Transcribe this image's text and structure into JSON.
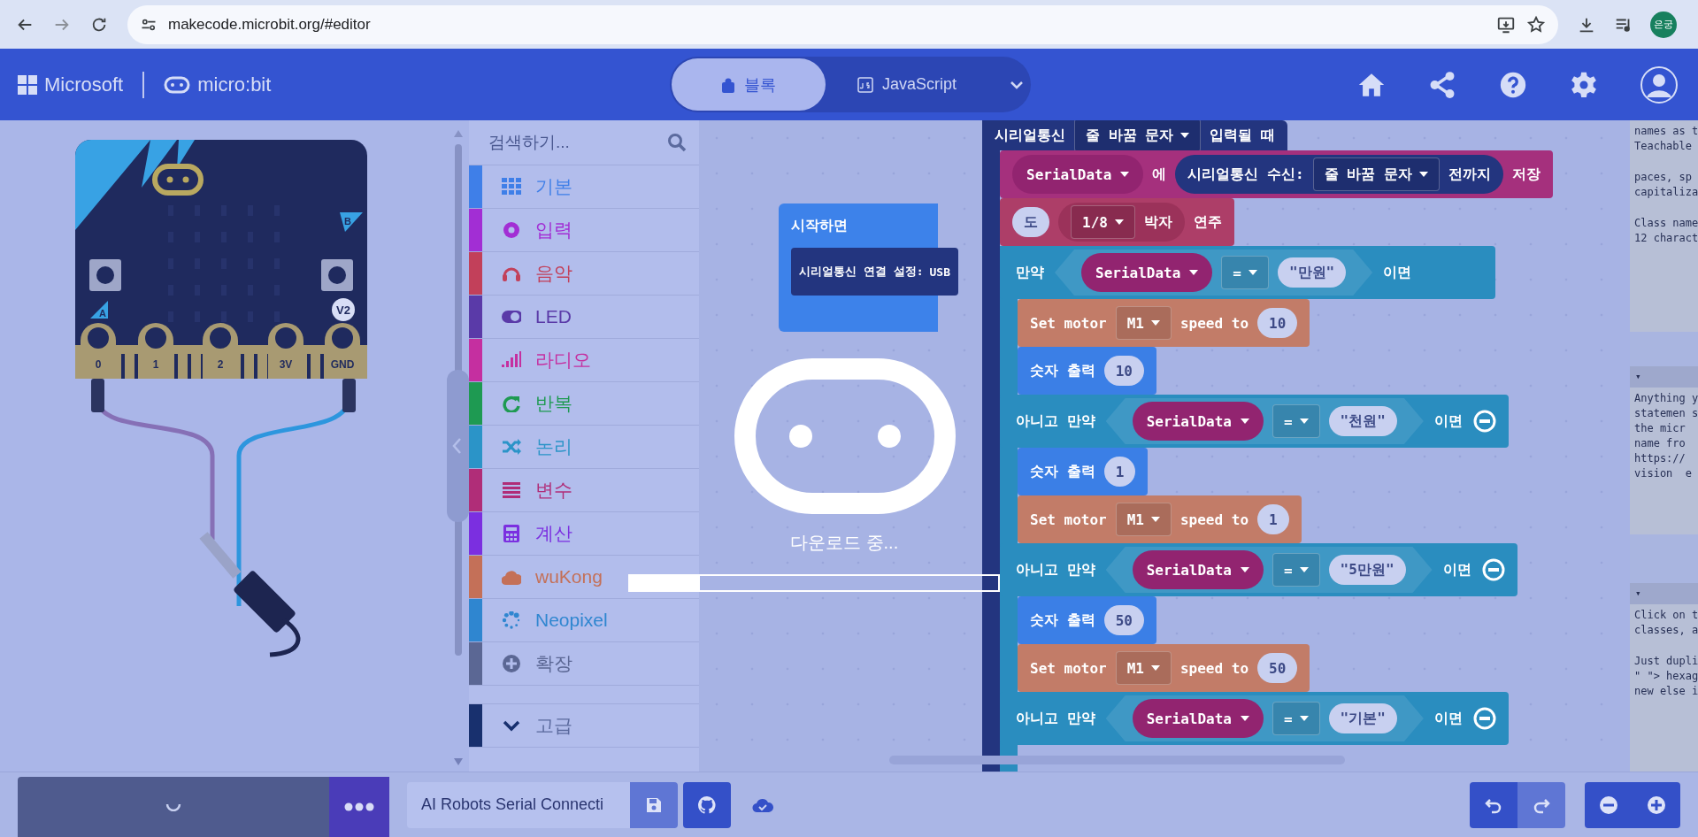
{
  "browser": {
    "url": "makecode.microbit.org/#editor",
    "profile": "은궁"
  },
  "header": {
    "brand": "Microsoft",
    "product": "micro:bit",
    "editor_tabs": [
      {
        "label": "블록",
        "selected": true
      },
      {
        "label": "JavaScript",
        "selected": false
      }
    ]
  },
  "simulator": {
    "pins": [
      "0",
      "1",
      "2",
      "3V",
      "GND"
    ],
    "buttons": [
      "A",
      "B"
    ],
    "version": "V2"
  },
  "toolbox": {
    "placeholder": "검색하기...",
    "categories": [
      {
        "label": "기본",
        "color": "#3f7fe8"
      },
      {
        "label": "입력",
        "color": "#a22ed4"
      },
      {
        "label": "음악",
        "color": "#c2405a"
      },
      {
        "label": "LED",
        "color": "#5a3aa8"
      },
      {
        "label": "라디오",
        "color": "#c52fa0"
      },
      {
        "label": "반복",
        "color": "#1e9a52"
      },
      {
        "label": "논리",
        "color": "#2b94c8"
      },
      {
        "label": "변수",
        "color": "#b02d78"
      },
      {
        "label": "계산",
        "color": "#7b2fe0"
      },
      {
        "label": "wuKong",
        "color": "#c47058"
      },
      {
        "label": "Neopixel",
        "color": "#2f86d0"
      },
      {
        "label": "확장",
        "color": "#5b6794"
      }
    ],
    "advanced": {
      "label": "고급",
      "color": "#18306e"
    }
  },
  "workspace": {
    "blocks": [
      {
        "kind": "event",
        "color": "#3d82ea",
        "parts": [
          {
            "kind": "label",
            "text": "시작하면"
          }
        ],
        "children": [
          {
            "kind": "statement",
            "color": "#23357f",
            "parts": [
              {
                "kind": "label",
                "text": "시리얼통신 연결 설정:"
              },
              {
                "kind": "field",
                "text": "USB"
              }
            ]
          }
        ]
      },
      {
        "kind": "event",
        "color": "#23357f",
        "parts": [
          {
            "kind": "label",
            "text": "시리얼통신"
          },
          {
            "kind": "dropdown",
            "text": "줄 바꿈 문자"
          },
          {
            "kind": "label",
            "text": "입력될 때"
          }
        ],
        "children": [
          {
            "kind": "statement",
            "color": "#a5307d",
            "parts": [
              {
                "kind": "variable",
                "color": "#922470",
                "text": "SerialData"
              },
              {
                "kind": "label",
                "text": "에"
              },
              {
                "kind": "reporter",
                "color": "#23357f",
                "parts": [
                  {
                    "kind": "label",
                    "text": "시리얼통신 수신:"
                  },
                  {
                    "kind": "dropdown",
                    "text": "줄 바꿈 문자"
                  },
                  {
                    "kind": "label",
                    "text": "전까지"
                  }
                ]
              },
              {
                "kind": "label",
                "text": "저장"
              }
            ]
          },
          {
            "kind": "statement",
            "color": "#ad3e68",
            "parts": [
              {
                "kind": "oval",
                "text": "도"
              },
              {
                "kind": "reporter",
                "color": "#9b325a",
                "parts": [
                  {
                    "kind": "dropdown",
                    "text": "1/8"
                  },
                  {
                    "kind": "label",
                    "text": "박자"
                  }
                ]
              },
              {
                "kind": "label",
                "text": "연주"
              }
            ]
          },
          {
            "kind": "if",
            "color": "#2a8dbf",
            "branches": [
              {
                "parts": [
                  {
                    "kind": "label",
                    "text": "만약"
                  },
                  {
                    "kind": "compare",
                    "parts": [
                      {
                        "kind": "variable",
                        "color": "#922470",
                        "text": "SerialData"
                      },
                      {
                        "kind": "dropdown",
                        "text": "="
                      },
                      {
                        "kind": "oval",
                        "text": "\"만원\""
                      }
                    ]
                  },
                  {
                    "kind": "label",
                    "text": "이면"
                  }
                ],
                "children": [
                  {
                    "kind": "statement",
                    "color": "#c27c68",
                    "parts": [
                      {
                        "kind": "label",
                        "text": "Set motor"
                      },
                      {
                        "kind": "dropdown",
                        "text": "M1"
                      },
                      {
                        "kind": "label",
                        "text": "speed to"
                      },
                      {
                        "kind": "oval",
                        "text": "10"
                      }
                    ]
                  },
                  {
                    "kind": "statement",
                    "color": "#3b7fe6",
                    "parts": [
                      {
                        "kind": "label",
                        "text": "숫자 출력"
                      },
                      {
                        "kind": "oval",
                        "text": "10"
                      }
                    ]
                  }
                ]
              },
              {
                "parts": [
                  {
                    "kind": "label",
                    "text": "아니고 만약"
                  },
                  {
                    "kind": "compare",
                    "parts": [
                      {
                        "kind": "variable",
                        "color": "#922470",
                        "text": "SerialData"
                      },
                      {
                        "kind": "dropdown",
                        "text": "="
                      },
                      {
                        "kind": "oval",
                        "text": "\"천원\""
                      }
                    ]
                  },
                  {
                    "kind": "label",
                    "text": "이면"
                  },
                  {
                    "kind": "minus"
                  }
                ],
                "children": [
                  {
                    "kind": "statement",
                    "color": "#3b7fe6",
                    "parts": [
                      {
                        "kind": "label",
                        "text": "숫자 출력"
                      },
                      {
                        "kind": "oval",
                        "text": "1"
                      }
                    ]
                  },
                  {
                    "kind": "statement",
                    "color": "#c27c68",
                    "parts": [
                      {
                        "kind": "label",
                        "text": "Set motor"
                      },
                      {
                        "kind": "dropdown",
                        "text": "M1"
                      },
                      {
                        "kind": "label",
                        "text": "speed to"
                      },
                      {
                        "kind": "oval",
                        "text": "1"
                      }
                    ]
                  }
                ]
              },
              {
                "parts": [
                  {
                    "kind": "label",
                    "text": "아니고 만약"
                  },
                  {
                    "kind": "compare",
                    "parts": [
                      {
                        "kind": "variable",
                        "color": "#922470",
                        "text": "SerialData"
                      },
                      {
                        "kind": "dropdown",
                        "text": "="
                      },
                      {
                        "kind": "oval",
                        "text": "\"5만원\""
                      }
                    ]
                  },
                  {
                    "kind": "label",
                    "text": "이면"
                  },
                  {
                    "kind": "minus"
                  }
                ],
                "children": [
                  {
                    "kind": "statement",
                    "color": "#3b7fe6",
                    "parts": [
                      {
                        "kind": "label",
                        "text": "숫자 출력"
                      },
                      {
                        "kind": "oval",
                        "text": "50"
                      }
                    ]
                  },
                  {
                    "kind": "statement",
                    "color": "#c27c68",
                    "parts": [
                      {
                        "kind": "label",
                        "text": "Set motor"
                      },
                      {
                        "kind": "dropdown",
                        "text": "M1"
                      },
                      {
                        "kind": "label",
                        "text": "speed to"
                      },
                      {
                        "kind": "oval",
                        "text": "50"
                      }
                    ]
                  }
                ]
              },
              {
                "parts": [
                  {
                    "kind": "label",
                    "text": "아니고 만약"
                  },
                  {
                    "kind": "compare",
                    "parts": [
                      {
                        "kind": "variable",
                        "color": "#922470",
                        "text": "SerialData"
                      },
                      {
                        "kind": "dropdown",
                        "text": "="
                      },
                      {
                        "kind": "oval",
                        "text": "\"기본\""
                      }
                    ]
                  },
                  {
                    "kind": "label",
                    "text": "이면"
                  },
                  {
                    "kind": "minus"
                  }
                ]
              }
            ]
          }
        ]
      }
    ]
  },
  "loading": {
    "message": "다운로드 중...",
    "level": 0.19
  },
  "side_panels": [
    {
      "paragraphs": [
        [
          "names as t",
          "Teachable"
        ],
        [
          "paces, sp",
          "capitaliza"
        ],
        [
          "Class name",
          "12 charact"
        ]
      ]
    },
    {
      "toggle": "▾",
      "paragraphs": [
        [
          "Anything y",
          "statemen s",
          "the micr",
          "name fro",
          "https://",
          "vision  e"
        ]
      ]
    },
    {
      "toggle": "▾",
      "paragraphs": [
        [
          "Click on t",
          "classes, a"
        ],
        [
          "Just dupli",
          "\" \"> hexag",
          "new else i"
        ]
      ]
    }
  ],
  "footer": {
    "project_name": "AI Robots Serial Connecti"
  }
}
